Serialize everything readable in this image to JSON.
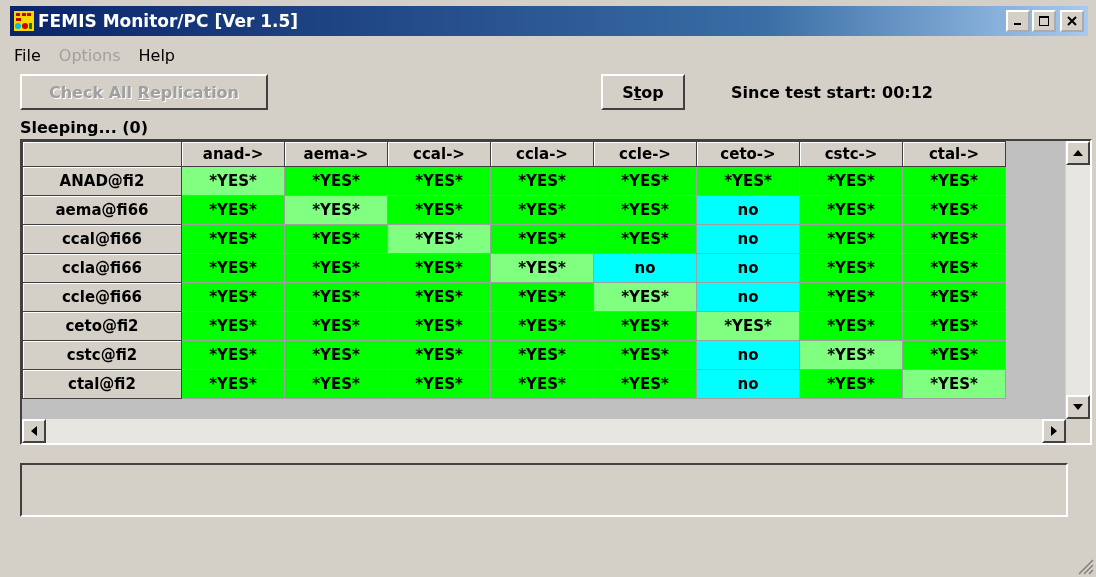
{
  "window": {
    "title": "FEMIS Monitor/PC [Ver 1.5]"
  },
  "menu": [
    {
      "label": "File",
      "disabled": false
    },
    {
      "label": "Options",
      "disabled": true
    },
    {
      "label": "Help",
      "disabled": false
    }
  ],
  "check_button": {
    "label_parts": [
      "Check All ",
      "R",
      "eplication"
    ],
    "disabled": true
  },
  "stop_button": {
    "label_parts": [
      "S",
      "t",
      "op"
    ],
    "disabled": false
  },
  "elapsed": "Since test start: 00:12",
  "status": "Sleeping... (0)",
  "grid": {
    "columns": [
      "anad->",
      "aema->",
      "ccal->",
      "ccla->",
      "ccle->",
      "ceto->",
      "cstc->",
      "ctal->"
    ],
    "rows": [
      {
        "name": "ANAD@fi2",
        "cells": [
          {
            "text": "*YES*",
            "kind": "self"
          },
          {
            "text": "*YES*",
            "kind": "yes"
          },
          {
            "text": "*YES*",
            "kind": "yes"
          },
          {
            "text": "*YES*",
            "kind": "yes"
          },
          {
            "text": "*YES*",
            "kind": "yes"
          },
          {
            "text": "*YES*",
            "kind": "yes"
          },
          {
            "text": "*YES*",
            "kind": "yes"
          },
          {
            "text": "*YES*",
            "kind": "yes"
          }
        ]
      },
      {
        "name": "aema@fi66",
        "cells": [
          {
            "text": "*YES*",
            "kind": "yes"
          },
          {
            "text": "*YES*",
            "kind": "self"
          },
          {
            "text": "*YES*",
            "kind": "yes"
          },
          {
            "text": "*YES*",
            "kind": "yes"
          },
          {
            "text": "*YES*",
            "kind": "yes"
          },
          {
            "text": "no",
            "kind": "no"
          },
          {
            "text": "*YES*",
            "kind": "yes"
          },
          {
            "text": "*YES*",
            "kind": "yes"
          }
        ]
      },
      {
        "name": "ccal@fi66",
        "cells": [
          {
            "text": "*YES*",
            "kind": "yes"
          },
          {
            "text": "*YES*",
            "kind": "yes"
          },
          {
            "text": "*YES*",
            "kind": "self"
          },
          {
            "text": "*YES*",
            "kind": "yes"
          },
          {
            "text": "*YES*",
            "kind": "yes"
          },
          {
            "text": "no",
            "kind": "no"
          },
          {
            "text": "*YES*",
            "kind": "yes"
          },
          {
            "text": "*YES*",
            "kind": "yes"
          }
        ]
      },
      {
        "name": "ccla@fi66",
        "cells": [
          {
            "text": "*YES*",
            "kind": "yes"
          },
          {
            "text": "*YES*",
            "kind": "yes"
          },
          {
            "text": "*YES*",
            "kind": "yes"
          },
          {
            "text": "*YES*",
            "kind": "self"
          },
          {
            "text": "no",
            "kind": "no"
          },
          {
            "text": "no",
            "kind": "no"
          },
          {
            "text": "*YES*",
            "kind": "yes"
          },
          {
            "text": "*YES*",
            "kind": "yes"
          }
        ]
      },
      {
        "name": "ccle@fi66",
        "cells": [
          {
            "text": "*YES*",
            "kind": "yes"
          },
          {
            "text": "*YES*",
            "kind": "yes"
          },
          {
            "text": "*YES*",
            "kind": "yes"
          },
          {
            "text": "*YES*",
            "kind": "yes"
          },
          {
            "text": "*YES*",
            "kind": "self"
          },
          {
            "text": "no",
            "kind": "no"
          },
          {
            "text": "*YES*",
            "kind": "yes"
          },
          {
            "text": "*YES*",
            "kind": "yes"
          }
        ]
      },
      {
        "name": "ceto@fi2",
        "cells": [
          {
            "text": "*YES*",
            "kind": "yes"
          },
          {
            "text": "*YES*",
            "kind": "yes"
          },
          {
            "text": "*YES*",
            "kind": "yes"
          },
          {
            "text": "*YES*",
            "kind": "yes"
          },
          {
            "text": "*YES*",
            "kind": "yes"
          },
          {
            "text": "*YES*",
            "kind": "self"
          },
          {
            "text": "*YES*",
            "kind": "yes"
          },
          {
            "text": "*YES*",
            "kind": "yes"
          }
        ]
      },
      {
        "name": "cstc@fi2",
        "cells": [
          {
            "text": "*YES*",
            "kind": "yes"
          },
          {
            "text": "*YES*",
            "kind": "yes"
          },
          {
            "text": "*YES*",
            "kind": "yes"
          },
          {
            "text": "*YES*",
            "kind": "yes"
          },
          {
            "text": "*YES*",
            "kind": "yes"
          },
          {
            "text": "no",
            "kind": "no"
          },
          {
            "text": "*YES*",
            "kind": "self"
          },
          {
            "text": "*YES*",
            "kind": "yes"
          }
        ]
      },
      {
        "name": "ctal@fi2",
        "cells": [
          {
            "text": "*YES*",
            "kind": "yes"
          },
          {
            "text": "*YES*",
            "kind": "yes"
          },
          {
            "text": "*YES*",
            "kind": "yes"
          },
          {
            "text": "*YES*",
            "kind": "yes"
          },
          {
            "text": "*YES*",
            "kind": "yes"
          },
          {
            "text": "no",
            "kind": "no"
          },
          {
            "text": "*YES*",
            "kind": "yes"
          },
          {
            "text": "*YES*",
            "kind": "self"
          }
        ]
      }
    ]
  }
}
